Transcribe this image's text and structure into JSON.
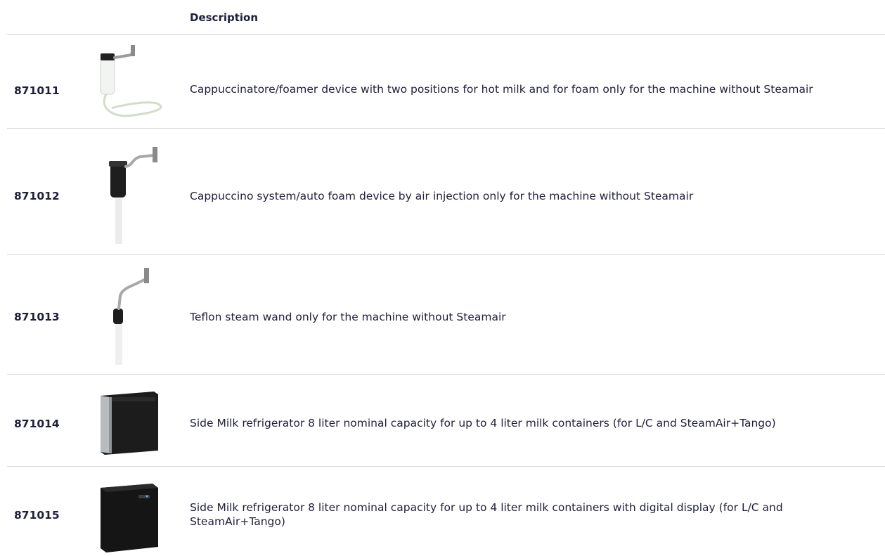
{
  "table": {
    "header": {
      "description_label": "Description"
    },
    "rows": [
      {
        "code": "871011",
        "description": "Cappuccinatore/foamer device with two positions for hot milk and for foam only for the machine without Steamair",
        "image_icon": "cappuccinatore-foamer-icon"
      },
      {
        "code": "871012",
        "description": "Cappuccino system/auto foam device by air injection only for the machine without Steamair",
        "image_icon": "auto-foam-device-icon"
      },
      {
        "code": "871013",
        "description": "Teflon steam wand only for the machine without Steamair",
        "image_icon": "steam-wand-icon"
      },
      {
        "code": "871014",
        "description": "Side Milk refrigerator 8 liter nominal capacity for up to 4 liter milk containers (for L/C and SteamAir+Tango)",
        "image_icon": "milk-refrigerator-icon"
      },
      {
        "code": "871015",
        "description": "Side Milk refrigerator 8 liter nominal capacity for up to 4 liter milk containers with digital display (for L/C and SteamAir+Tango)",
        "image_icon": "milk-refrigerator-display-icon"
      }
    ]
  },
  "colors": {
    "text": "#1f1f3d",
    "divider": "#d6d6d6",
    "background": "#ffffff"
  }
}
